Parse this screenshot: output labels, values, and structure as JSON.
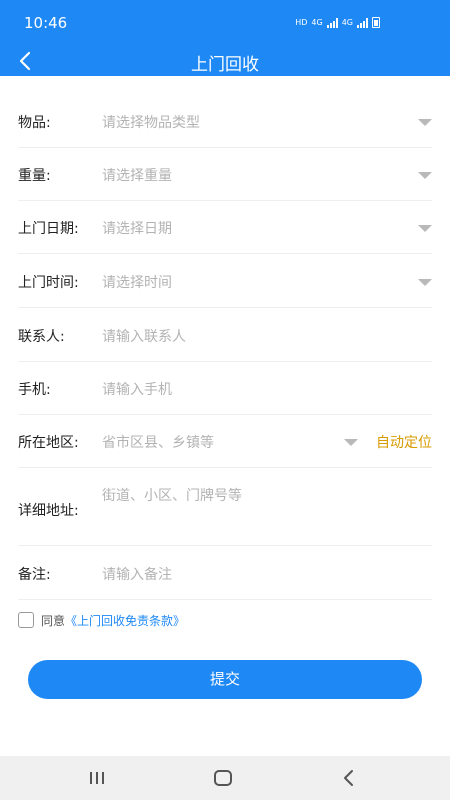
{
  "status_bar": {
    "time": "10:46",
    "indicators": [
      "HD",
      "4G",
      "4G"
    ]
  },
  "header": {
    "back_icon": "chevron-left-icon",
    "title": "上门回收"
  },
  "form": {
    "item": {
      "label": "物品:",
      "placeholder": "请选择物品类型"
    },
    "weight": {
      "label": "重量:",
      "placeholder": "请选择重量"
    },
    "date": {
      "label": "上门日期:",
      "placeholder": "请选择日期"
    },
    "time": {
      "label": "上门时间:",
      "placeholder": "请选择时间"
    },
    "contact": {
      "label": "联系人:",
      "placeholder": "请输入联系人"
    },
    "phone": {
      "label": "手机:",
      "placeholder": "请输入手机"
    },
    "region": {
      "label": "所在地区:",
      "placeholder": "省市区县、乡镇等",
      "locate_label": "自动定位"
    },
    "address": {
      "label": "详细地址:",
      "placeholder": "街道、小区、门牌号等"
    },
    "note": {
      "label": "备注:",
      "placeholder": "请输入备注"
    }
  },
  "agreement": {
    "prefix": "同意",
    "link": "《上门回收免责条款》",
    "checked": false
  },
  "submit_label": "提交",
  "colors": {
    "primary": "#1e88f5",
    "locate": "#d79b00",
    "placeholder": "#b3b3b3"
  },
  "system_nav": [
    "recent-apps-icon",
    "home-icon",
    "back-icon"
  ]
}
